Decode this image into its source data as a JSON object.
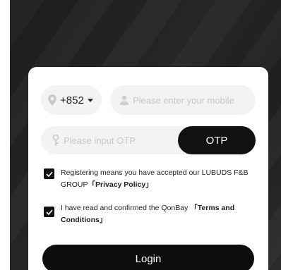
{
  "country_code": {
    "value": "+852",
    "icon": "location-pin-icon",
    "dropdown_icon": "caret-down-icon"
  },
  "mobile": {
    "placeholder": "Please enter your mobile",
    "icon": "person-icon"
  },
  "otp": {
    "placeholder": "Please input OTP",
    "icon": "key-icon",
    "button_label": "OTP"
  },
  "agreements": [
    {
      "checked": true,
      "text_prefix": "Registering means you have accepted our LUBUDS F&B GROUP",
      "link_text": "「Privacy Policy」"
    },
    {
      "checked": true,
      "text_prefix": "I have read and confirmed the QonBay",
      "link_text": "「Terms and Conditions」"
    }
  ],
  "login": {
    "label": "Login"
  },
  "colors": {
    "primary": "#0d0d0d",
    "field_bg": "#f3f3f3",
    "placeholder": "#c7c7c7",
    "background": "#222222"
  }
}
